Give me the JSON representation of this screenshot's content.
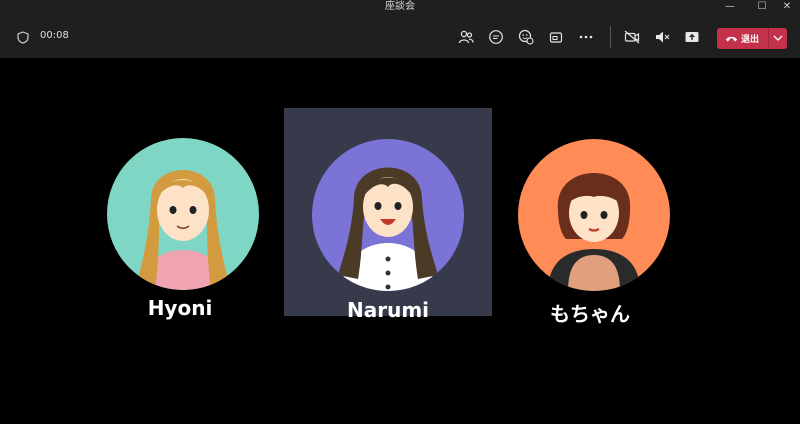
{
  "window": {
    "title": "座談会",
    "minimize_icon": "minimize-icon",
    "maximize_icon": "maximize-icon",
    "close_icon": "close-icon"
  },
  "toolbar": {
    "timer": "00:08",
    "icons": [
      "shield-icon",
      "people-icon",
      "chat-icon",
      "reactions-icon",
      "share-tray-icon",
      "more-icon",
      "camera-off-icon",
      "mic-muted-icon",
      "share-screen-icon"
    ],
    "leave_label": "退出"
  },
  "participants": [
    {
      "name": "Hyoni",
      "avatar_bg": "#7fd6c4",
      "active": false
    },
    {
      "name": "Narumi",
      "avatar_bg": "#7b73d6",
      "active": true
    },
    {
      "name": "もちゃん",
      "avatar_bg": "#ff8c57",
      "active": false
    }
  ],
  "colors": {
    "leave_button": "#c4314b",
    "active_tile": "#363a4b",
    "toolbar_bg": "#1f1f1f"
  }
}
